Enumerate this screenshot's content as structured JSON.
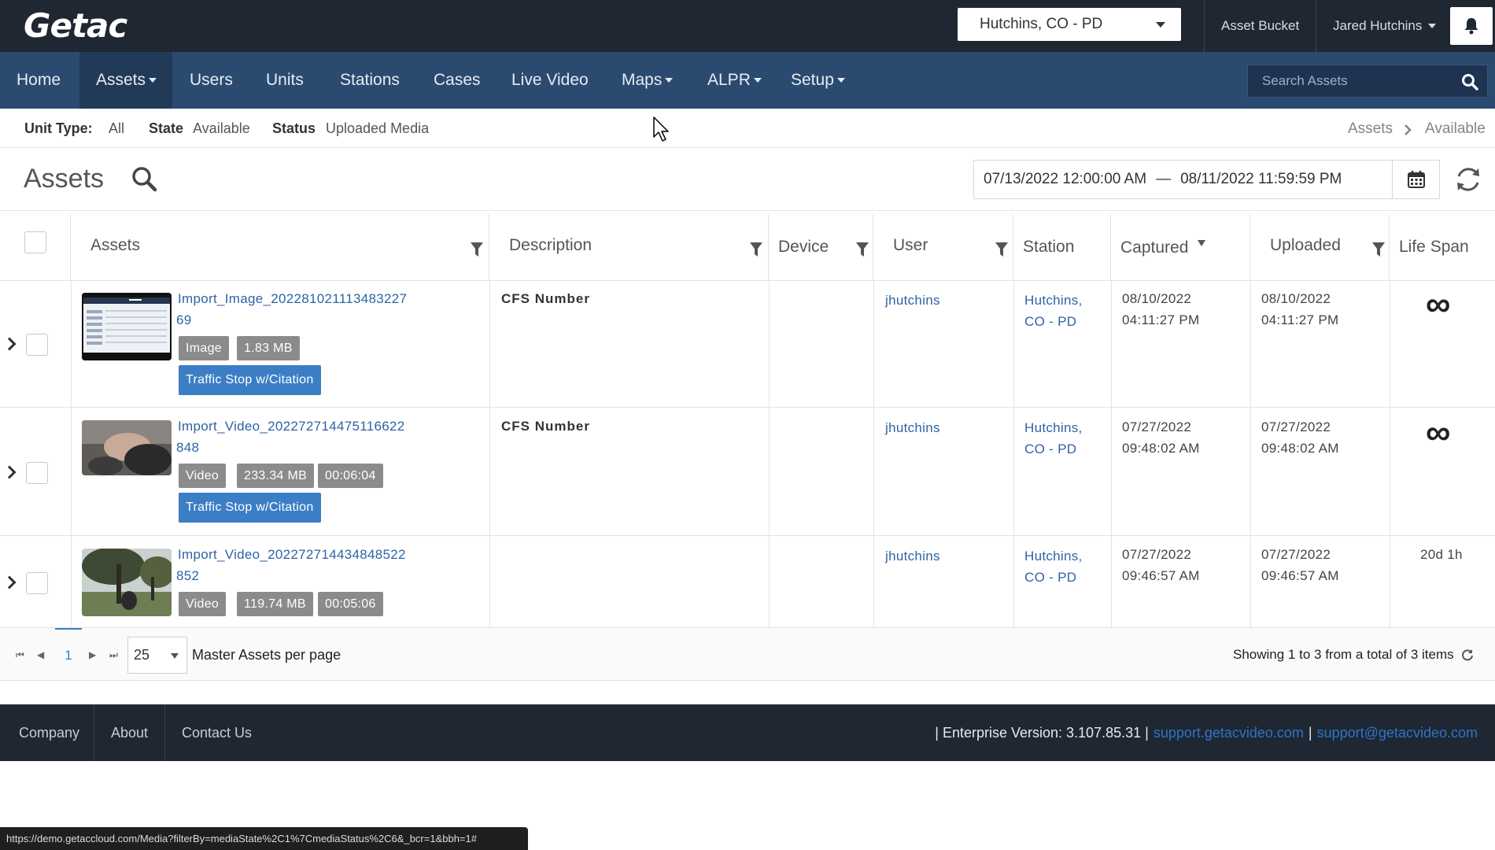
{
  "brand": {
    "logo": "Getac"
  },
  "topbar": {
    "agency": "Hutchins, CO - PD",
    "asset_bucket": "Asset Bucket",
    "user": "Jared Hutchins"
  },
  "nav": {
    "items": [
      {
        "label": "Home"
      },
      {
        "label": "Assets"
      },
      {
        "label": "Users"
      },
      {
        "label": "Units"
      },
      {
        "label": "Stations"
      },
      {
        "label": "Cases"
      },
      {
        "label": "Live Video"
      },
      {
        "label": "Maps"
      },
      {
        "label": "ALPR"
      },
      {
        "label": "Setup"
      }
    ],
    "active": "Assets",
    "search_placeholder": "Search Assets"
  },
  "filters": {
    "unit_type_label": "Unit Type:",
    "unit_type_value": "All",
    "state_label": "State",
    "state_value": "Available",
    "status_label": "Status",
    "status_value": "Uploaded Media"
  },
  "breadcrumb": {
    "parent": "Assets",
    "current": "Available"
  },
  "page": {
    "title": "Assets",
    "date_from": "07/13/2022 12:00:00 AM",
    "date_sep": "—",
    "date_to": "08/11/2022 11:59:59 PM"
  },
  "table": {
    "columns": [
      "Assets",
      "Description",
      "Device",
      "User",
      "Station",
      "Captured",
      "Uploaded",
      "Life Span"
    ],
    "rows": [
      {
        "name_line1": "Import_Image_202281021113483227",
        "name_line2": "69",
        "type": "Image",
        "size": "1.83 MB",
        "duration": "",
        "category": "Traffic Stop w/Citation",
        "description": "CFS Number",
        "device": "",
        "user": "jhutchins",
        "station_line1": "Hutchins,",
        "station_line2": "CO - PD",
        "captured_date": "08/10/2022",
        "captured_time": "04:11:27 PM",
        "uploaded_date": "08/10/2022",
        "uploaded_time": "04:11:27 PM",
        "life_span": "∞"
      },
      {
        "name_line1": "Import_Video_202272714475116622",
        "name_line2": "848",
        "type": "Video",
        "size": "233.34 MB",
        "duration": "00:06:04",
        "category": "Traffic Stop w/Citation",
        "description": "CFS Number",
        "device": "",
        "user": "jhutchins",
        "station_line1": "Hutchins,",
        "station_line2": "CO - PD",
        "captured_date": "07/27/2022",
        "captured_time": "09:48:02 AM",
        "uploaded_date": "07/27/2022",
        "uploaded_time": "09:48:02 AM",
        "life_span": "∞"
      },
      {
        "name_line1": "Import_Video_202272714434848522",
        "name_line2": "852",
        "type": "Video",
        "size": "119.74 MB",
        "duration": "00:05:06",
        "category": "",
        "description": "",
        "device": "",
        "user": "jhutchins",
        "station_line1": "Hutchins,",
        "station_line2": "CO - PD",
        "captured_date": "07/27/2022",
        "captured_time": "09:46:57 AM",
        "uploaded_date": "07/27/2022",
        "uploaded_time": "09:46:57 AM",
        "life_span": "20d 1h"
      }
    ]
  },
  "pager": {
    "current_page": "1",
    "per_page": "25",
    "per_page_label": "Master Assets per page",
    "summary": "Showing 1 to 3 from a total of 3 items"
  },
  "footer": {
    "links": [
      "Company",
      "About",
      "Contact Us"
    ],
    "version": "| Enterprise Version: 3.107.85.31 |",
    "support_site": "support.getacvideo.com",
    "sep": "|",
    "support_email": "support@getacvideo.com"
  },
  "statusbar": {
    "url": "https://demo.getaccloud.com/Media?filterBy=mediaState%2C1%7CmediaStatus%2C6&_bcr=1&bbh=1#"
  },
  "colors": {
    "topbar": "#1f2733",
    "navbar": "#2b4a70",
    "link": "#2f63a4",
    "category": "#3b7ec6",
    "tag": "#8b8b8b"
  }
}
